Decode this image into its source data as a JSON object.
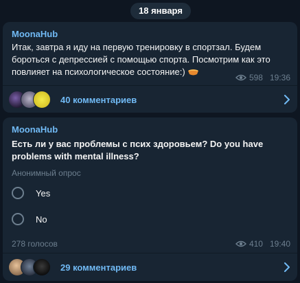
{
  "date_label": "18 января",
  "posts": [
    {
      "author": "MoonaHub",
      "text": "Итак, завтра я иду на первую тренировку в спортзал. Будем бороться с депрессией с помощью спорта. Посмотрим как это повлияет на психологическое состояние:)",
      "emoji_icon": "bowl-icon",
      "views": "598",
      "time": "19:36",
      "comments_label": "40 комментариев"
    },
    {
      "author": "MoonaHub",
      "poll_question": "Есть ли у вас проблемы с псих здоровьем? Do you have problems with mental illness?",
      "poll_type": "Анонимный опрос",
      "options": [
        "Yes",
        "No"
      ],
      "votes_label": "278 голосов",
      "views": "410",
      "time": "19:40",
      "comments_label": "29 комментариев"
    }
  ],
  "colors": {
    "background": "#0e1621",
    "bubble": "#182533",
    "accent": "#71baf5",
    "muted": "#6d7f8f"
  }
}
